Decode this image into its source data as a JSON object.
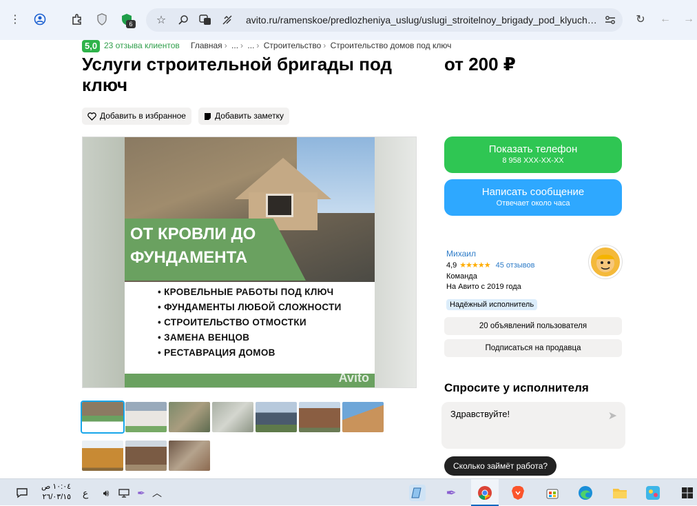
{
  "browser": {
    "url": "avito.ru/ramenskoe/predlozheniya_uslug/uslugi_stroitelnoy_brigady_pod_klyuch_...",
    "extension_badge": "6"
  },
  "header": {
    "rating": "5,0",
    "reviews_link": "23 отзыва клиентов",
    "breadcrumbs": [
      "Главная",
      "...",
      "...",
      "Строительство",
      "Строительство домов под ключ"
    ]
  },
  "listing": {
    "title": "Услуги строительной бригады под ключ",
    "price": "от 200 ₽",
    "favorite_label": "Добавить в избранное",
    "note_label": "Добавить заметку"
  },
  "gallery": {
    "headline": "ОТ КРОВЛИ ДО ФУНДАМЕНТА",
    "bullets": [
      "КРОВЕЛЬНЫЕ РАБОТЫ ПОД КЛЮЧ",
      "ФУНДАМЕНТЫ ЛЮБОЙ СЛОЖНОСТИ",
      "СТРОИТЕЛЬСТВО ОТМОСТКИ",
      "ЗАМЕНА ВЕНЦОВ",
      "РЕСТАВРАЦИЯ ДОМОВ"
    ],
    "watermark": "Avito"
  },
  "contact": {
    "show_phone": "Показать телефон",
    "phone_masked": "8 958 XXX-XX-XX",
    "write_message": "Написать сообщение",
    "reply_time": "Отвечает около часа"
  },
  "seller": {
    "name": "Михаил",
    "rating": "4,9",
    "stars": "★★★★★",
    "reviews": "45 отзывов",
    "type": "Команда",
    "since": "На Авито с 2019 года",
    "badge": "Надёжный исполнитель",
    "listings_button": "20 объявлений пользователя",
    "subscribe_button": "Подписаться на продавца"
  },
  "ask": {
    "title": "Спросите у исполнителя",
    "message": "Здравствуйте!",
    "suggestion": "Сколько займёт работа?"
  },
  "taskbar": {
    "time": "١٠:٠٤ ص",
    "date": "٢٦/٠٣/١٥",
    "lang": "ع"
  },
  "colors": {
    "avito_green": "#2fc653",
    "avito_blue": "#2ea8ff",
    "link_blue": "#2e7cc8",
    "rating_green": "#2fb34a"
  }
}
